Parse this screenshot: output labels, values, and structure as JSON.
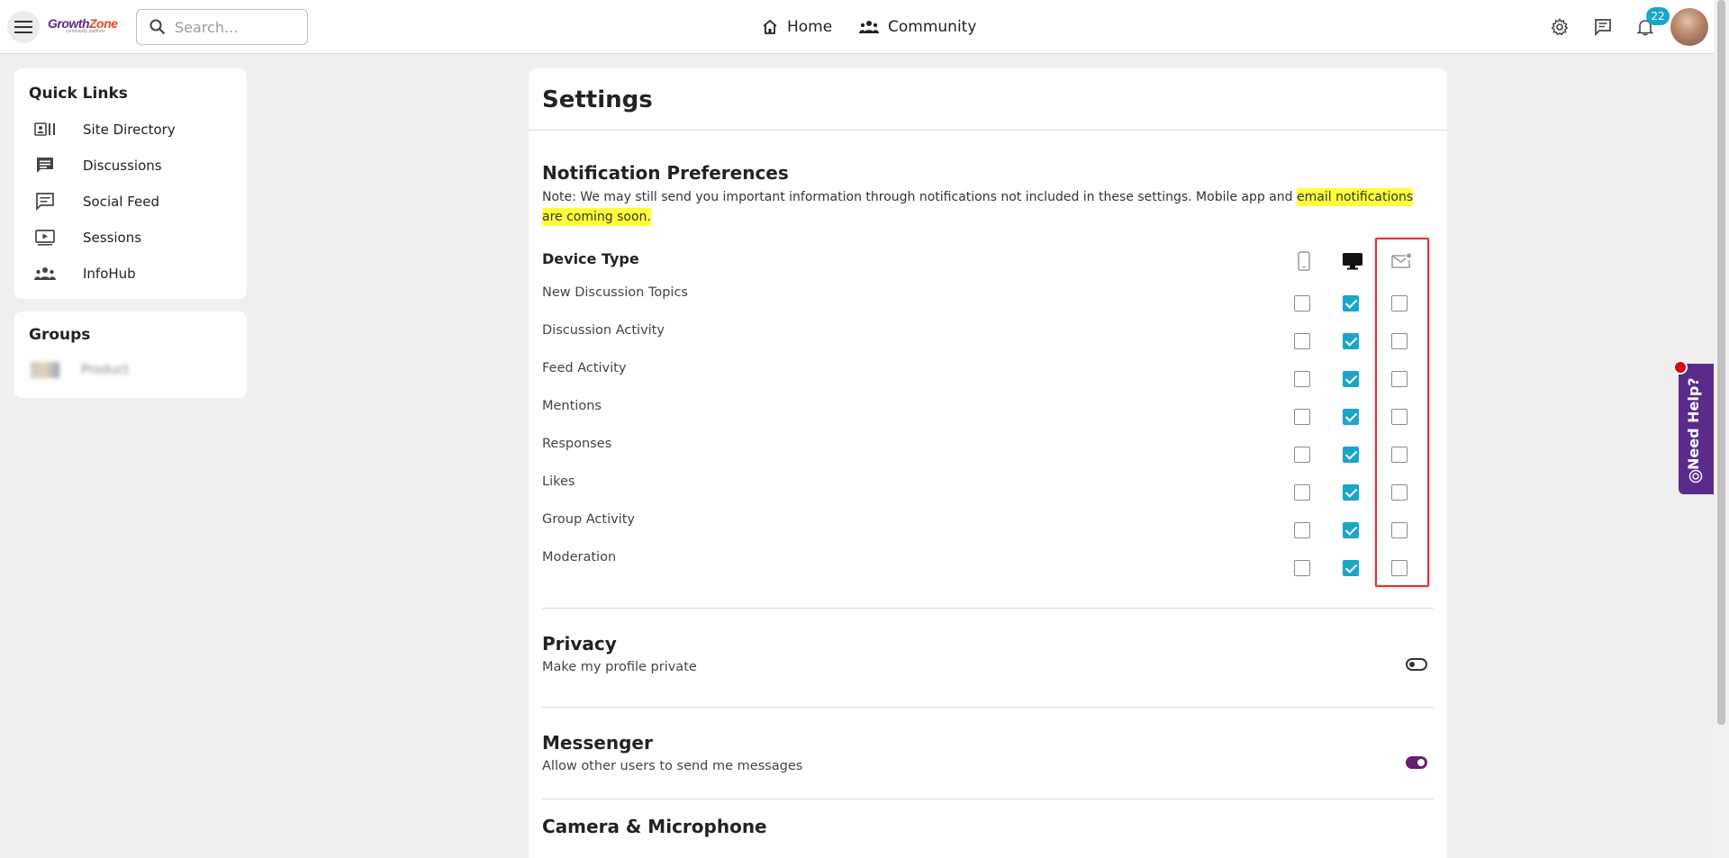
{
  "header": {
    "logo_text_main": "Growth",
    "logo_text_accent": "Zone",
    "logo_subtext": "community platform",
    "search_placeholder": "Search...",
    "nav": [
      {
        "label": "Home",
        "icon": "home-icon"
      },
      {
        "label": "Community",
        "icon": "community-icon"
      }
    ],
    "notification_count": "22",
    "colors": {
      "accent": "#1aa6c8",
      "brand": "#5a2d82"
    }
  },
  "sidebar": {
    "quick_links_title": "Quick Links",
    "quick_links": [
      {
        "label": "Site Directory",
        "icon": "directory-icon"
      },
      {
        "label": "Discussions",
        "icon": "discussions-icon"
      },
      {
        "label": "Social Feed",
        "icon": "social-feed-icon"
      },
      {
        "label": "Sessions",
        "icon": "sessions-icon"
      },
      {
        "label": "InfoHub",
        "icon": "infohub-icon"
      }
    ],
    "groups_title": "Groups",
    "groups": [
      {
        "label": "Product"
      }
    ]
  },
  "settings": {
    "title": "Settings",
    "notifications": {
      "title": "Notification Preferences",
      "note_plain": "Note: We may still send you important information through notifications not included in these settings. Mobile app and ",
      "note_highlight": "email notifications are coming soon.",
      "device_type_label": "Device Type",
      "columns": [
        "mobile-icon",
        "desktop-icon",
        "email-icon"
      ],
      "rows": [
        {
          "label": "New Discussion Topics",
          "mobile": false,
          "desktop": true,
          "email": false
        },
        {
          "label": "Discussion Activity",
          "mobile": false,
          "desktop": true,
          "email": false
        },
        {
          "label": "Feed Activity",
          "mobile": false,
          "desktop": true,
          "email": false
        },
        {
          "label": "Mentions",
          "mobile": false,
          "desktop": true,
          "email": false
        },
        {
          "label": "Responses",
          "mobile": false,
          "desktop": true,
          "email": false
        },
        {
          "label": "Likes",
          "mobile": false,
          "desktop": true,
          "email": false
        },
        {
          "label": "Group Activity",
          "mobile": false,
          "desktop": true,
          "email": false
        },
        {
          "label": "Moderation",
          "mobile": false,
          "desktop": true,
          "email": false
        }
      ]
    },
    "privacy": {
      "title": "Privacy",
      "description": "Make my profile private",
      "enabled": false
    },
    "messenger": {
      "title": "Messenger",
      "description": "Allow other users to send me messages",
      "enabled": true
    },
    "camera": {
      "title": "Camera & Microphone"
    }
  },
  "help_widget": {
    "label": "Need Help?"
  }
}
